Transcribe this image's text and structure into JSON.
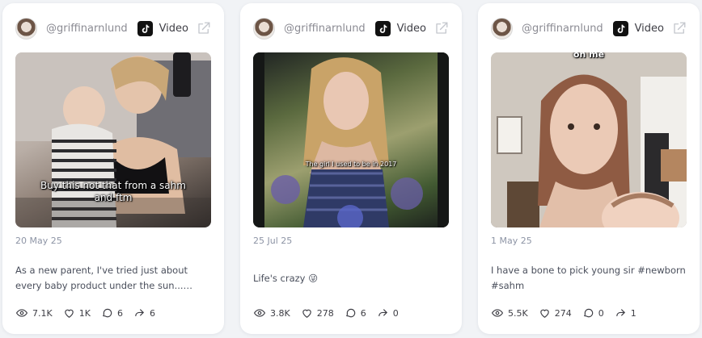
{
  "posts": [
    {
      "handle": "@griffinarnlund",
      "type_label": "Video",
      "caption": "Buy this not that from a sahm and ftm",
      "date": "20 May 25",
      "description": "As a new parent, I've tried just about every baby product under the sun... and...",
      "views": "7.1K",
      "likes": "1K",
      "comments": "6",
      "shares": "6"
    },
    {
      "handle": "@griffinarnlund",
      "type_label": "Video",
      "caption": "The girl I used to be in 2017",
      "date": "25 Jul 25",
      "description": "Life's crazy 😜",
      "views": "3.8K",
      "likes": "278",
      "comments": "6",
      "shares": "0"
    },
    {
      "handle": "@griffinarnlund",
      "type_label": "Video",
      "caption": "on me",
      "date": "1 May 25",
      "description": "I have a bone to pick young sir #newborn #sahm",
      "views": "5.5K",
      "likes": "274",
      "comments": "0",
      "shares": "1"
    }
  ],
  "icons": {
    "platform": "tiktok-icon",
    "open": "external-link-icon",
    "views": "eye-icon",
    "likes": "heart-icon",
    "comments": "comment-icon",
    "shares": "share-icon"
  },
  "colors": {
    "background": "#f1f3f6",
    "card": "#ffffff",
    "meta_text": "#8d94a5",
    "body_text": "#4a4f5c"
  }
}
